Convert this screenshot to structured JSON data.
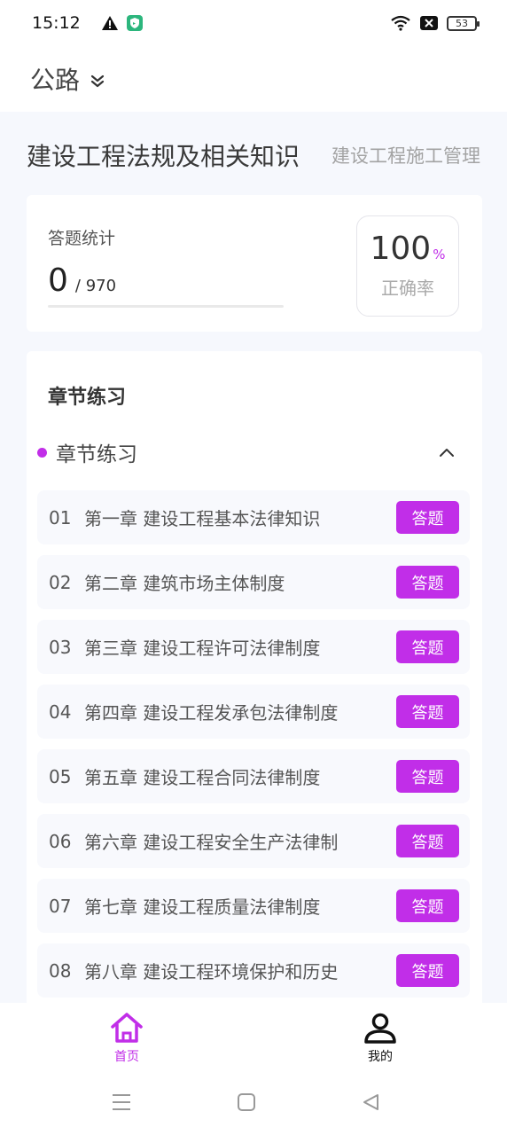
{
  "status_bar": {
    "time": "15:12",
    "battery": "53"
  },
  "header": {
    "subject": "公路"
  },
  "tabs": [
    {
      "label": "建设工程法规及相关知识",
      "active": true
    },
    {
      "label": "建设工程施工管理",
      "active": false
    }
  ],
  "stats": {
    "label": "答题统计",
    "answered": "0",
    "total": "/ 970",
    "progress": 0,
    "accuracy_value": "100",
    "accuracy_unit": "%",
    "accuracy_label": "正确率"
  },
  "practice": {
    "title": "章节练习",
    "group_label": "章节练习",
    "answer_button": "答题",
    "chapters": [
      {
        "num": "01",
        "name": "第一章 建设工程基本法律知识"
      },
      {
        "num": "02",
        "name": "第二章 建筑市场主体制度"
      },
      {
        "num": "03",
        "name": "第三章 建设工程许可法律制度"
      },
      {
        "num": "04",
        "name": "第四章 建设工程发承包法律制度"
      },
      {
        "num": "05",
        "name": "第五章 建设工程合同法律制度"
      },
      {
        "num": "06",
        "name": "第六章 建设工程安全生产法律制"
      },
      {
        "num": "07",
        "name": "第七章 建设工程质量法律制度"
      },
      {
        "num": "08",
        "name": "第八章 建设工程环境保护和历史"
      }
    ]
  },
  "bottom_nav": [
    {
      "label": "首页",
      "icon": "home-icon",
      "active": true
    },
    {
      "label": "我的",
      "icon": "user-icon",
      "active": false
    }
  ],
  "colors": {
    "accent": "#c12ee8",
    "background": "#f6f8fd"
  }
}
